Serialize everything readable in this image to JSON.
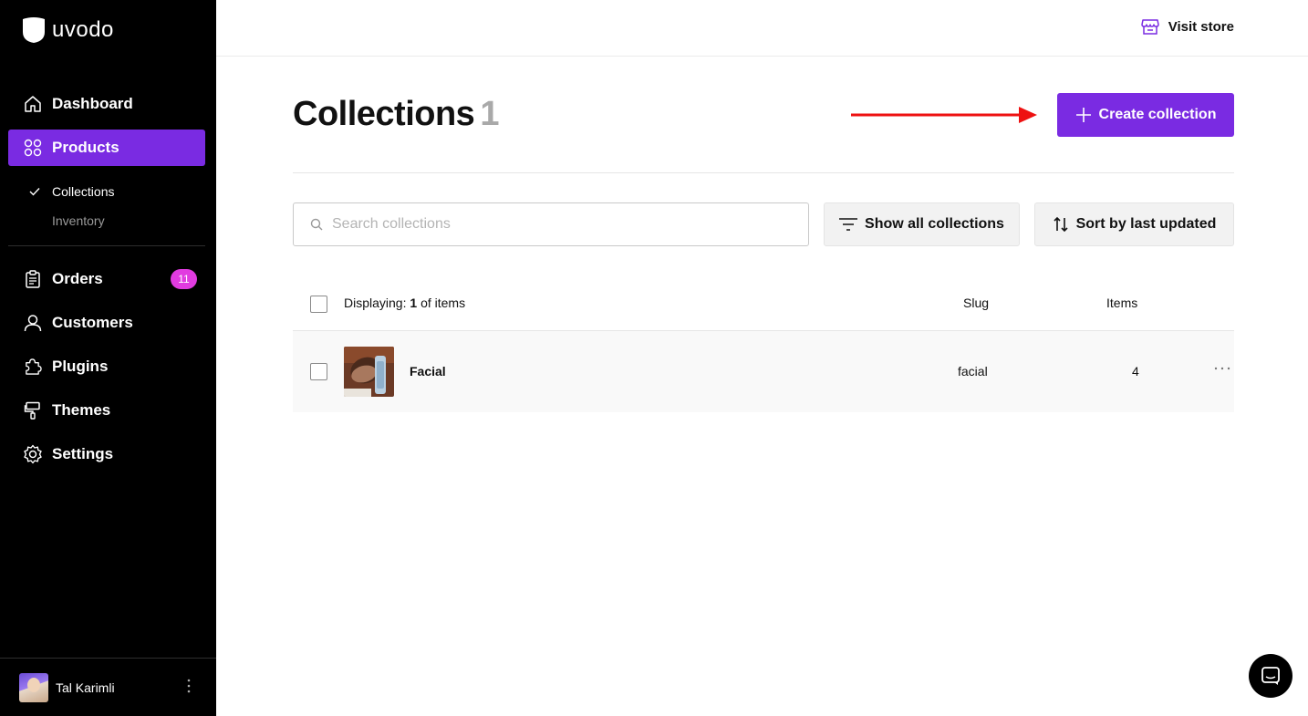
{
  "brand": {
    "name": "uvodo",
    "accent": "#7a2be2",
    "badge_color": "#e13be0"
  },
  "sidebar": {
    "items": [
      {
        "label": "Dashboard",
        "icon": "home-icon"
      },
      {
        "label": "Products",
        "icon": "grid-icon",
        "active": true
      },
      {
        "label": "Orders",
        "icon": "clipboard-icon",
        "badge": "11"
      },
      {
        "label": "Customers",
        "icon": "user-icon"
      },
      {
        "label": "Plugins",
        "icon": "puzzle-icon"
      },
      {
        "label": "Themes",
        "icon": "paint-roller-icon"
      },
      {
        "label": "Settings",
        "icon": "gear-icon"
      }
    ],
    "subitems": [
      {
        "label": "Collections",
        "checked": true
      },
      {
        "label": "Inventory"
      }
    ],
    "user": {
      "name": "Tal Karimli"
    }
  },
  "topbar": {
    "visit_store": "Visit store",
    "visit_store_icon": "store-icon"
  },
  "main": {
    "title": "Collections",
    "count": "1",
    "create_button": "Create collection",
    "search_placeholder": "Search collections",
    "filter_button": "Show all collections",
    "sort_button": "Sort by last updated",
    "table": {
      "displaying_prefix": "Displaying:",
      "displaying_count": "1",
      "displaying_suffix": "of items",
      "headers": {
        "slug": "Slug",
        "items": "Items"
      },
      "rows": [
        {
          "name": "Facial",
          "slug": "facial",
          "items": "4"
        }
      ]
    }
  }
}
